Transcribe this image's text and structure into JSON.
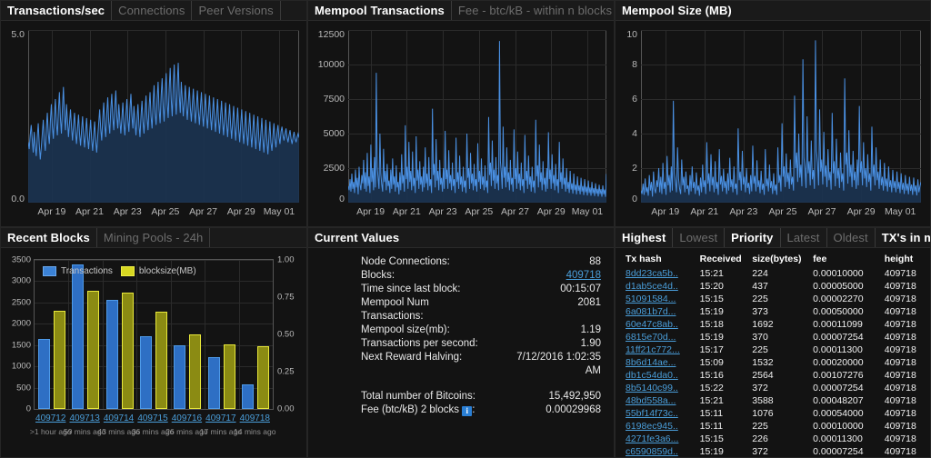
{
  "panels": {
    "tps": {
      "tabs": [
        {
          "label": "Transactions/sec",
          "active": true
        },
        {
          "label": "Connections",
          "active": false
        },
        {
          "label": "Peer Versions",
          "active": false
        }
      ]
    },
    "mempool_tx": {
      "tabs": [
        {
          "label": "Mempool Transactions",
          "active": true
        },
        {
          "label": "Fee - btc/kB - within n blocks",
          "active": false
        }
      ]
    },
    "mempool_size": {
      "tabs": [
        {
          "label": "Mempool Size (MB)",
          "active": true
        }
      ]
    },
    "recent_blocks": {
      "tabs": [
        {
          "label": "Recent Blocks",
          "active": true
        },
        {
          "label": "Mining Pools - 24h",
          "active": false
        }
      ]
    },
    "current_values": {
      "tabs": [
        {
          "label": "Current Values",
          "active": true
        }
      ]
    },
    "mempool_table": {
      "tabs": [
        {
          "label": "Highest",
          "active": true
        },
        {
          "label": "Lowest",
          "active": false
        },
        {
          "label": "Priority",
          "active": true
        },
        {
          "label": "Latest",
          "active": false
        },
        {
          "label": "Oldest",
          "active": false
        },
        {
          "label": "TX's in mempool",
          "active": true
        }
      ]
    }
  },
  "current_values": {
    "rows": [
      {
        "key": "Node Connections:",
        "value": "88",
        "link": false
      },
      {
        "key": "Blocks:",
        "value": "409718",
        "link": true
      },
      {
        "key": "Time since last block:",
        "value": "00:15:07",
        "link": false
      },
      {
        "key": "Mempool Num",
        "value": "2081",
        "link": false
      },
      {
        "key": "Transactions:",
        "value": "",
        "link": false
      },
      {
        "key": "Mempool size(mb):",
        "value": "1.19",
        "link": false
      },
      {
        "key": "Transactions per second:",
        "value": "1.90",
        "link": false
      },
      {
        "key": "Next Reward Halving:",
        "value": "7/12/2016 1:02:35",
        "link": false
      }
    ],
    "halving_second_line": "AM",
    "rows_tail": [
      {
        "key": "Total number of Bitcoins:",
        "value": "15,492,950",
        "link": false
      }
    ],
    "fee_row": {
      "key_before": "Fee (btc/kB) 2 blocks",
      "info_icon": "info-icon",
      "key_after": ":",
      "value": "0.00029968"
    }
  },
  "mempool_table": {
    "columns": [
      "Tx hash",
      "Received",
      "size(bytes)",
      "fee",
      "height"
    ],
    "rows": [
      [
        "8dd23ca5b..",
        "15:21",
        "224",
        "0.00010000",
        "409718"
      ],
      [
        "d1ab5ce4d..",
        "15:20",
        "437",
        "0.00005000",
        "409718"
      ],
      [
        "51091584...",
        "15:15",
        "225",
        "0.00002270",
        "409718"
      ],
      [
        "6a081b7d...",
        "15:19",
        "373",
        "0.00050000",
        "409718"
      ],
      [
        "60e47c8ab..",
        "15:18",
        "1692",
        "0.00011099",
        "409718"
      ],
      [
        "6815e70d...",
        "15:19",
        "370",
        "0.00007254",
        "409718"
      ],
      [
        "11ff21c772...",
        "15:17",
        "225",
        "0.00011300",
        "409718"
      ],
      [
        "8b6d14ae...",
        "15:09",
        "1532",
        "0.00020000",
        "409718"
      ],
      [
        "db1c54da0..",
        "15:16",
        "2564",
        "0.00107276",
        "409718"
      ],
      [
        "8b5140c99..",
        "15:22",
        "372",
        "0.00007254",
        "409718"
      ],
      [
        "48bd558a...",
        "15:21",
        "3588",
        "0.00048207",
        "409718"
      ],
      [
        "55bf14f73c..",
        "15:11",
        "1076",
        "0.00054000",
        "409718"
      ],
      [
        "6198ec945..",
        "15:11",
        "225",
        "0.00010000",
        "409718"
      ],
      [
        "4271fe3a6...",
        "15:15",
        "226",
        "0.00011300",
        "409718"
      ],
      [
        "c6590859d..",
        "15:19",
        "372",
        "0.00007254",
        "409718"
      ]
    ]
  },
  "chart_data": [
    {
      "id": "transactions_per_sec",
      "type": "area",
      "title": "Transactions/sec",
      "xlabel": "",
      "ylabel": "",
      "ylim": [
        0.0,
        5.0
      ],
      "yticks": [
        "0.0",
        "5.0"
      ],
      "ytick_values": [
        0.0,
        5.0
      ],
      "xticks": [
        "Apr 19",
        "Apr 21",
        "Apr 23",
        "Apr 25",
        "Apr 27",
        "Apr 29",
        "May 01"
      ],
      "grid": true,
      "legend": "none",
      "line_color": "#4a90e2",
      "fill_color": "#1b3350",
      "values": [
        1.75,
        1.55,
        1.95,
        2.25,
        1.85,
        1.45,
        2.05,
        1.65,
        1.35,
        1.9,
        2.3,
        1.7,
        1.25,
        1.6,
        2.0,
        2.4,
        1.8,
        1.5,
        2.15,
        2.6,
        2.0,
        1.7,
        2.35,
        2.85,
        2.2,
        1.85,
        2.5,
        3.0,
        2.3,
        1.95,
        2.65,
        3.2,
        2.45,
        2.0,
        2.75,
        3.35,
        2.55,
        2.1,
        2.85,
        2.4,
        1.9,
        2.3,
        2.7,
        2.2,
        1.8,
        2.25,
        2.6,
        2.05,
        1.7,
        2.15,
        2.55,
        2.0,
        1.65,
        2.1,
        2.5,
        1.95,
        1.6,
        2.05,
        2.45,
        1.9,
        1.55,
        2.0,
        2.4,
        1.85,
        1.5,
        1.95,
        2.35,
        1.8,
        1.45,
        1.9,
        2.3,
        2.7,
        2.15,
        1.8,
        2.45,
        2.9,
        2.25,
        1.9,
        2.6,
        3.05,
        2.35,
        2.0,
        2.7,
        3.15,
        2.45,
        2.1,
        2.8,
        3.25,
        2.5,
        2.15,
        2.85,
        2.4,
        2.0,
        2.45,
        2.9,
        2.3,
        1.95,
        2.55,
        3.0,
        2.4,
        2.05,
        2.7,
        3.15,
        2.5,
        2.15,
        2.8,
        2.35,
        1.95,
        2.4,
        2.85,
        2.25,
        1.9,
        2.5,
        2.95,
        2.35,
        2.0,
        2.65,
        3.1,
        2.45,
        2.1,
        2.75,
        3.2,
        2.5,
        2.15,
        2.9,
        3.4,
        2.6,
        2.25,
        3.0,
        3.5,
        2.7,
        2.3,
        3.1,
        3.6,
        2.8,
        2.35,
        3.2,
        3.75,
        2.9,
        2.45,
        3.3,
        3.9,
        3.0,
        2.5,
        3.4,
        4.0,
        3.05,
        2.55,
        3.45,
        4.05,
        3.1,
        2.6,
        3.5,
        3.0,
        2.5,
        2.95,
        3.4,
        2.85,
        2.4,
        2.9,
        3.35,
        2.75,
        2.35,
        2.85,
        3.3,
        2.7,
        2.3,
        2.8,
        3.25,
        2.65,
        2.25,
        2.75,
        3.2,
        2.6,
        2.2,
        2.7,
        3.15,
        2.55,
        2.15,
        2.65,
        3.1,
        2.5,
        2.1,
        2.6,
        3.05,
        2.45,
        2.05,
        2.55,
        3.0,
        2.4,
        2.0,
        2.5,
        2.95,
        2.35,
        1.95,
        2.45,
        2.9,
        2.3,
        1.9,
        2.4,
        2.85,
        2.25,
        1.85,
        2.35,
        2.8,
        2.2,
        1.8,
        2.3,
        2.75,
        2.15,
        1.75,
        2.25,
        2.7,
        2.1,
        1.7,
        2.2,
        2.65,
        2.05,
        1.65,
        2.15,
        2.6,
        2.0,
        1.6,
        2.1,
        2.55,
        1.95,
        1.55,
        2.05,
        2.5,
        1.9,
        1.5,
        2.0,
        2.45,
        1.85,
        1.45,
        1.95,
        2.4,
        1.8,
        1.4,
        1.9,
        2.35,
        1.75,
        1.5,
        1.95,
        2.3,
        1.85,
        1.6,
        2.0,
        2.25,
        1.9,
        1.7,
        2.05,
        2.2,
        1.95,
        1.8,
        2.0,
        2.15,
        1.9,
        1.75,
        1.95,
        2.1,
        1.85,
        1.7,
        1.9,
        2.05,
        1.85,
        1.75,
        1.9,
        2.0,
        1.88
      ]
    },
    {
      "id": "mempool_transactions",
      "type": "area",
      "title": "Mempool Transactions",
      "xlabel": "",
      "ylabel": "",
      "ylim": [
        0,
        12500
      ],
      "yticks": [
        "0",
        "2500",
        "5000",
        "7500",
        "10000",
        "12500"
      ],
      "ytick_values": [
        0,
        2500,
        5000,
        7500,
        10000,
        12500
      ],
      "xticks": [
        "Apr 19",
        "Apr 21",
        "Apr 23",
        "Apr 25",
        "Apr 27",
        "Apr 29",
        "May 01"
      ],
      "grid": true,
      "legend": "none",
      "line_color": "#4a90e2",
      "fill_color": "#1b3350",
      "values": [
        1200,
        900,
        1700,
        800,
        2100,
        1000,
        1500,
        700,
        2400,
        1100,
        1800,
        600,
        2600,
        1300,
        900,
        2000,
        1400,
        3100,
        1000,
        2200,
        800,
        3600,
        1200,
        1900,
        700,
        4200,
        1500,
        2500,
        900,
        3300,
        1100,
        9400,
        2600,
        1800,
        1000,
        5000,
        2100,
        1300,
        800,
        3900,
        1500,
        2300,
        900,
        2800,
        1200,
        1600,
        700,
        2400,
        1000,
        3200,
        1300,
        1900,
        800,
        2700,
        1100,
        1500,
        600,
        2200,
        900,
        3500,
        1400,
        2000,
        800,
        5600,
        1700,
        2600,
        1000,
        4400,
        1500,
        2300,
        900,
        3700,
        1200,
        1800,
        700,
        4800,
        1600,
        2400,
        1000,
        3000,
        1300,
        1900,
        800,
        2600,
        1100,
        4000,
        1400,
        2100,
        900,
        3300,
        1200,
        1700,
        700,
        6800,
        2000,
        2800,
        1100,
        4600,
        1600,
        2300,
        900,
        3100,
        1300,
        1800,
        800,
        2500,
        1000,
        5200,
        1700,
        2400,
        1000,
        3800,
        1400,
        2000,
        900,
        2900,
        1200,
        1700,
        700,
        4700,
        1500,
        2200,
        1000,
        3400,
        1300,
        1900,
        800,
        2600,
        1100,
        1600,
        700,
        5000,
        1800,
        2500,
        1000,
        3600,
        1400,
        2100,
        900,
        2800,
        1200,
        1700,
        800,
        4300,
        1500,
        2300,
        1000,
        3200,
        1300,
        1900,
        900,
        2700,
        1100,
        1600,
        700,
        6200,
        2000,
        2900,
        1200,
        4500,
        1600,
        2400,
        1000,
        3300,
        1400,
        2000,
        900,
        11700,
        3000,
        2200,
        1000,
        5500,
        1800,
        2600,
        1100,
        4000,
        1500,
        2200,
        900,
        3100,
        1300,
        1800,
        800,
        5300,
        1700,
        2500,
        1000,
        3700,
        1400,
        2100,
        900,
        2900,
        1200,
        1700,
        700,
        4900,
        1600,
        2300,
        1000,
        3400,
        1300,
        1900,
        800,
        2600,
        1100,
        1600,
        700,
        6000,
        1900,
        2700,
        1100,
        4200,
        1500,
        2200,
        900,
        3000,
        1300,
        1800,
        800,
        2500,
        1000,
        5100,
        1700,
        2400,
        1000,
        3500,
        1400,
        2000,
        900,
        2800,
        1200,
        1700,
        700,
        4400,
        1500,
        2200,
        1000,
        3200,
        1300,
        1800,
        800,
        2500,
        1000,
        1500,
        700,
        2300,
        950,
        1400,
        650,
        2100,
        900,
        1300,
        600,
        1900,
        850,
        1250,
        600,
        1800,
        800,
        1200,
        550,
        1700,
        750,
        1150,
        520,
        1600,
        700,
        1100,
        500,
        1500,
        680,
        1050,
        480,
        1400,
        650,
        1000,
        450,
        1300,
        620,
        980,
        430,
        1250,
        600,
        950,
        420,
        2081
      ]
    },
    {
      "id": "mempool_size_mb",
      "type": "area",
      "title": "Mempool Size (MB)",
      "xlabel": "",
      "ylabel": "",
      "ylim": [
        0,
        10
      ],
      "yticks": [
        "0",
        "2",
        "4",
        "6",
        "8",
        "10"
      ],
      "ytick_values": [
        0,
        2,
        4,
        6,
        8,
        10
      ],
      "xticks": [
        "Apr 19",
        "Apr 21",
        "Apr 23",
        "Apr 25",
        "Apr 27",
        "Apr 29",
        "May 01"
      ],
      "grid": true,
      "legend": "none",
      "line_color": "#4a90e2",
      "fill_color": "#1b3350",
      "values": [
        0.7,
        0.5,
        1.1,
        0.45,
        1.4,
        0.6,
        0.9,
        0.4,
        1.6,
        0.7,
        1.2,
        0.35,
        1.8,
        0.8,
        0.55,
        1.3,
        0.9,
        2.0,
        0.6,
        1.5,
        0.5,
        2.3,
        0.8,
        1.2,
        0.45,
        2.7,
        1.0,
        1.6,
        0.6,
        2.1,
        0.7,
        5.9,
        1.7,
        1.2,
        0.6,
        3.2,
        1.4,
        0.8,
        0.5,
        2.5,
        1.0,
        1.5,
        0.6,
        1.8,
        0.8,
        1.0,
        0.45,
        1.6,
        0.65,
        2.1,
        0.85,
        1.2,
        0.5,
        1.75,
        0.7,
        1.0,
        0.4,
        1.45,
        0.6,
        2.2,
        0.9,
        1.3,
        0.5,
        3.5,
        1.1,
        1.7,
        0.65,
        2.8,
        1.0,
        1.5,
        0.6,
        2.4,
        0.8,
        1.2,
        0.45,
        3.1,
        1.05,
        1.55,
        0.65,
        1.95,
        0.85,
        1.25,
        0.5,
        1.7,
        0.7,
        2.6,
        0.9,
        1.35,
        0.6,
        2.1,
        0.8,
        1.1,
        0.45,
        4.3,
        1.3,
        1.8,
        0.7,
        3.0,
        1.05,
        1.5,
        0.6,
        2.0,
        0.85,
        1.15,
        0.5,
        1.6,
        0.65,
        3.3,
        1.1,
        1.55,
        0.65,
        2.45,
        0.9,
        1.3,
        0.55,
        1.85,
        0.75,
        1.1,
        0.45,
        3.1,
        0.95,
        1.4,
        0.65,
        2.2,
        0.85,
        1.25,
        0.5,
        1.7,
        0.7,
        1.05,
        0.45,
        3.2,
        1.15,
        1.6,
        0.65,
        4.6,
        1.5,
        2.1,
        0.9,
        2.85,
        1.2,
        1.75,
        0.8,
        2.5,
        1.05,
        1.5,
        0.7,
        6.2,
        2.0,
        2.9,
        1.2,
        4.0,
        1.45,
        2.2,
        0.95,
        8.3,
        2.6,
        1.95,
        0.85,
        5.0,
        1.7,
        2.4,
        1.0,
        3.6,
        1.35,
        1.9,
        0.8,
        9.4,
        3.0,
        2.3,
        1.0,
        5.4,
        1.8,
        2.5,
        1.05,
        4.1,
        1.5,
        2.15,
        0.9,
        3.1,
        1.3,
        1.8,
        0.75,
        5.2,
        1.7,
        2.4,
        0.95,
        3.7,
        1.4,
        2.0,
        0.85,
        2.9,
        1.2,
        1.7,
        0.7,
        7.2,
        2.2,
        2.9,
        1.1,
        4.2,
        1.5,
        2.2,
        0.9,
        3.0,
        1.3,
        1.8,
        0.8,
        2.5,
        1.0,
        5.6,
        1.75,
        2.4,
        1.0,
        3.5,
        1.4,
        2.0,
        0.9,
        2.8,
        1.2,
        1.7,
        0.7,
        4.4,
        1.5,
        2.2,
        1.0,
        3.2,
        1.3,
        1.8,
        0.8,
        2.5,
        1.0,
        1.5,
        0.7,
        2.3,
        0.95,
        1.4,
        0.65,
        2.1,
        0.9,
        1.3,
        0.6,
        1.9,
        0.85,
        1.25,
        0.6,
        1.8,
        0.8,
        1.2,
        0.55,
        1.7,
        0.75,
        1.15,
        0.5,
        1.6,
        0.7,
        1.1,
        0.48,
        1.5,
        0.68,
        1.05,
        0.45,
        1.45,
        0.65,
        1.0,
        0.42,
        1.35,
        0.6,
        0.95,
        1.19
      ]
    },
    {
      "id": "recent_blocks",
      "type": "bar",
      "title": "Recent Blocks",
      "categories": [
        "409712",
        "409713",
        "409714",
        "409715",
        "409716",
        "409717",
        "409718"
      ],
      "category_sublabels": [
        "",
        "",
        "",
        "",
        "",
        "",
        ""
      ],
      "series": [
        {
          "name": "Transactions",
          "color": "#3b82d6",
          "axis": "left",
          "values": [
            1640,
            3400,
            2560,
            1710,
            1490,
            1210,
            570
          ]
        },
        {
          "name": "blocksize(MB)",
          "color": "#d8d822",
          "axis": "right",
          "values": [
            0.66,
            0.79,
            0.78,
            0.65,
            0.5,
            0.43,
            0.42
          ]
        }
      ],
      "ylim": [
        0,
        3500
      ],
      "yticks": [
        "0",
        "500",
        "1000",
        "1500",
        "2000",
        "2500",
        "3000",
        "3500"
      ],
      "ylim_right": [
        0,
        1.0
      ],
      "yticks_right": [
        "0.00",
        "0.25",
        "0.50",
        "0.75",
        "1.00"
      ],
      "grid": true,
      "legend": "top-left",
      "block_links": [
        "409712",
        "409713",
        "409714",
        "409715",
        "409716",
        "409717",
        "409718"
      ],
      "block_ages": [
        ">1 hour ago",
        "59 mins ago",
        "43 mins ago",
        "36 mins ago",
        "26 mins ago",
        "17 mins ago",
        "14 mins ago"
      ]
    }
  ]
}
